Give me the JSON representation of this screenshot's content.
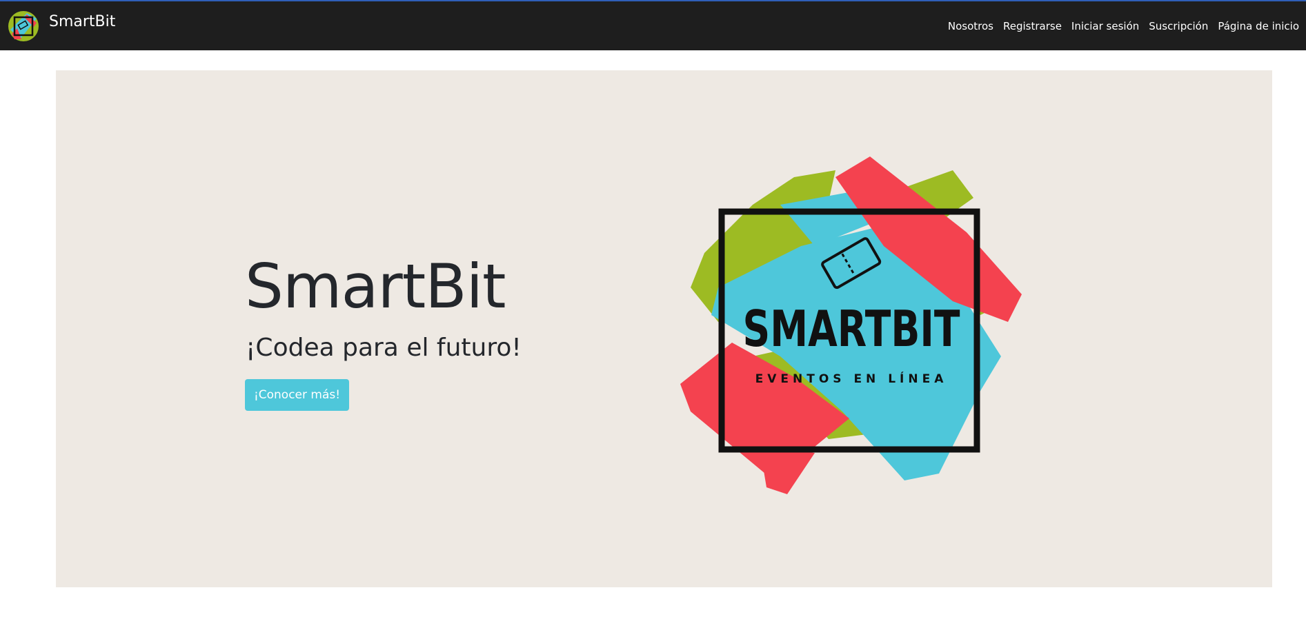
{
  "navbar": {
    "brand": "SmartBit",
    "brand_icon": "smartbit-logo-icon",
    "links": [
      "Nosotros",
      "Registrarse",
      "Iniciar sesión",
      "Suscripción",
      "Página de inicio"
    ]
  },
  "hero": {
    "title": "SmartBit",
    "subtitle": "¡Codea para el futuro!",
    "cta_label": "¡Conocer más!",
    "logo": {
      "wordmark": "SMARTBIT",
      "tagline": "EVENTOS EN LÍNEA",
      "icon": "ticket-icon"
    }
  },
  "colors": {
    "navbar_bg": "#1e1e1e",
    "hero_bg": "#eee9e3",
    "accent_cyan": "#4ec7da",
    "paint_green": "#9dbb23",
    "paint_red": "#f4424f",
    "paint_cyan": "#4ec7da"
  }
}
